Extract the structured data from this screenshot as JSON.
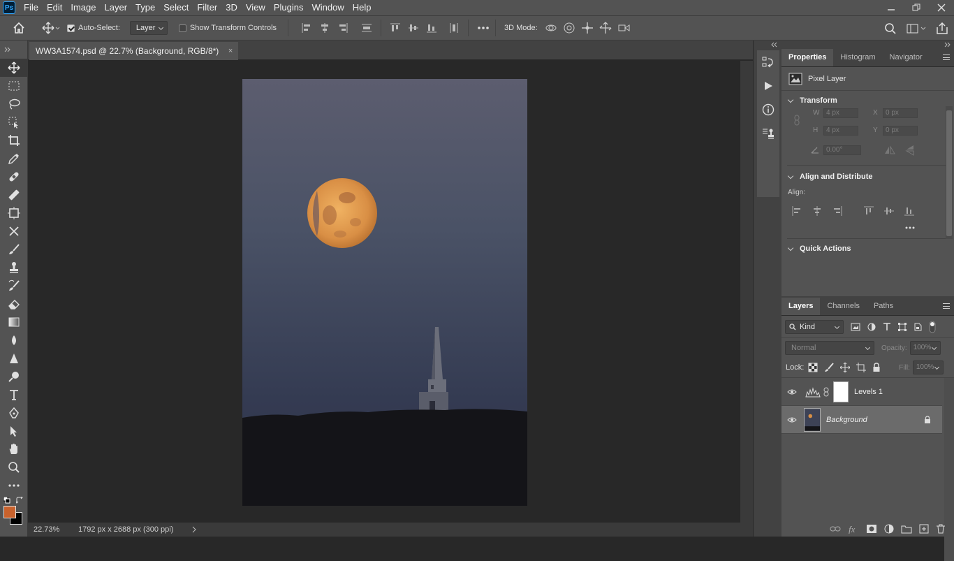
{
  "menubar": {
    "logo": "Ps",
    "items": [
      "File",
      "Edit",
      "Image",
      "Layer",
      "Type",
      "Select",
      "Filter",
      "3D",
      "View",
      "Plugins",
      "Window",
      "Help"
    ]
  },
  "options": {
    "auto_select_label": "Auto-Select:",
    "auto_select_checked": true,
    "layer_dropdown": "Layer",
    "show_transform_label": "Show Transform Controls",
    "show_transform_checked": false,
    "mode_3d_label": "3D Mode:"
  },
  "document": {
    "tab_title": "WW3A1574.psd @ 22.7% (Background, RGB/8*)",
    "close_glyph": "×",
    "zoom": "22.73%",
    "doc_info": "1792 px x 2688 px (300 ppi)"
  },
  "colors": {
    "foreground": "#c8622d",
    "background": "#000000",
    "accent": "#31a8ff"
  },
  "properties": {
    "tabs": [
      "Properties",
      "Histogram",
      "Navigator"
    ],
    "layer_kind": "Pixel Layer",
    "transform_title": "Transform",
    "w_label": "W",
    "w_value": "4 px",
    "h_label": "H",
    "h_value": "4 px",
    "x_label": "X",
    "x_value": "0 px",
    "y_label": "Y",
    "y_value": "0 px",
    "angle_value": "0.00°",
    "align_title": "Align and Distribute",
    "align_label": "Align:",
    "quick_actions_title": "Quick Actions"
  },
  "layers": {
    "tabs": [
      "Layers",
      "Channels",
      "Paths"
    ],
    "kind_filter": "Kind",
    "blend_mode": "Normal",
    "opacity_label": "Opacity:",
    "opacity_value": "100%",
    "lock_label": "Lock:",
    "fill_label": "Fill:",
    "fill_value": "100%",
    "items": [
      {
        "name": "Levels 1",
        "type": "adjustment",
        "visible": true,
        "selected": false
      },
      {
        "name": "Background",
        "type": "pixel",
        "visible": true,
        "selected": true,
        "locked": true
      }
    ]
  }
}
